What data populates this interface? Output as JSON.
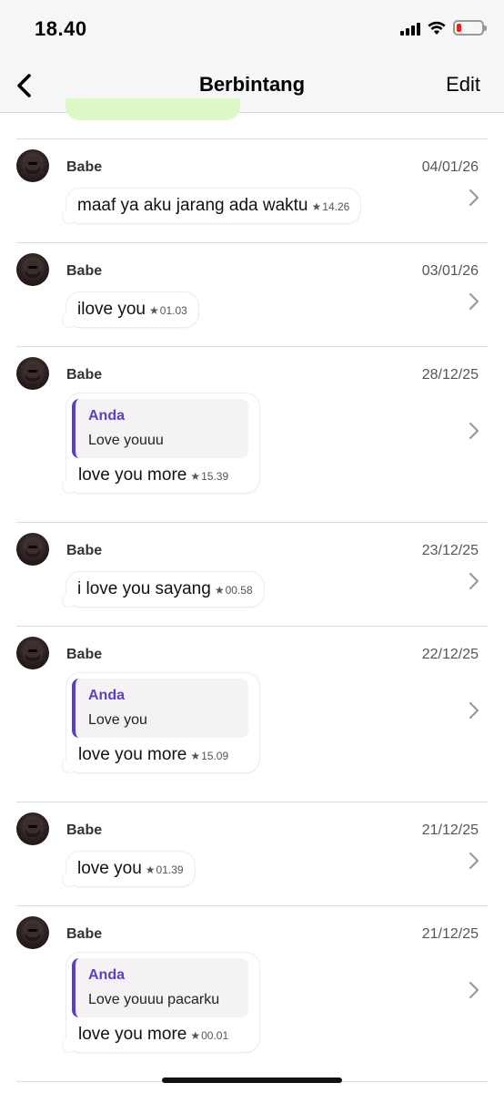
{
  "status_bar": {
    "time": "18.40",
    "battery_level": 0.18,
    "battery_color": "#e0261a"
  },
  "nav": {
    "back_icon": "chevron-left-icon",
    "title": "Berbintang",
    "edit_label": "Edit"
  },
  "colors": {
    "quote_accent": "#5b3fc7",
    "quote_author": "#5b3fc7"
  },
  "entries": [
    {
      "sender": "Babe",
      "date": "04/01/26",
      "quote_author": "",
      "quote_text": "",
      "text": "maaf ya aku jarang ada waktu",
      "star": "★",
      "time": "14.26"
    },
    {
      "sender": "Babe",
      "date": "03/01/26",
      "quote_author": "",
      "quote_text": "",
      "text": "ilove you",
      "star": "★",
      "time": "01.03"
    },
    {
      "sender": "Babe",
      "date": "28/12/25",
      "quote_author": "Anda",
      "quote_text": "Love youuu",
      "text": "love you more",
      "star": "★",
      "time": "15.39"
    },
    {
      "sender": "Babe",
      "date": "23/12/25",
      "quote_author": "",
      "quote_text": "",
      "text": "i love you sayang",
      "star": "★",
      "time": "00.58"
    },
    {
      "sender": "Babe",
      "date": "22/12/25",
      "quote_author": "Anda",
      "quote_text": "Love you",
      "text": "love you more",
      "star": "★",
      "time": "15.09"
    },
    {
      "sender": "Babe",
      "date": "21/12/25",
      "quote_author": "",
      "quote_text": "",
      "text": "love you",
      "star": "★",
      "time": "01.39"
    },
    {
      "sender": "Babe",
      "date": "21/12/25",
      "quote_author": "Anda",
      "quote_text": "Love youuu pacarku",
      "text": "love you more",
      "star": "★",
      "time": "00.01"
    }
  ]
}
